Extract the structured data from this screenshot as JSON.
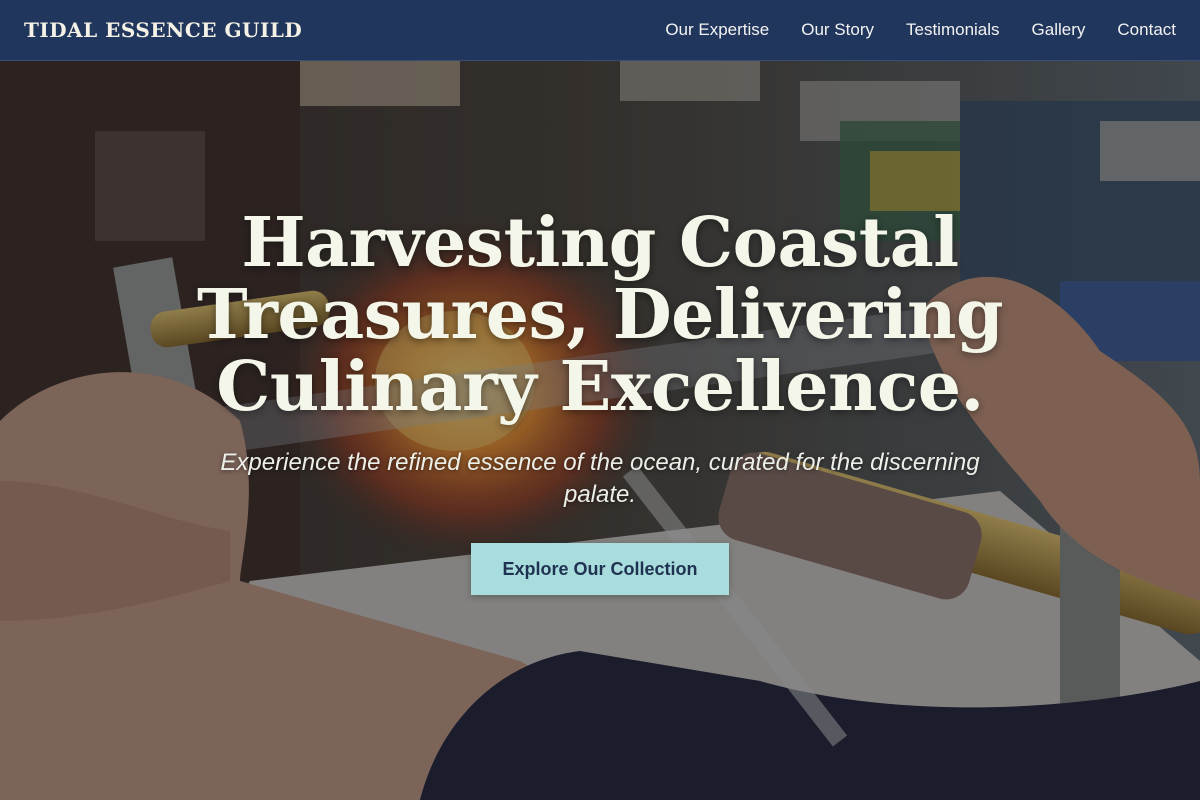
{
  "brand": {
    "name": "TIDAL ESSENCE GUILD"
  },
  "nav": {
    "links": [
      {
        "label": "Our Expertise"
      },
      {
        "label": "Our Story"
      },
      {
        "label": "Testimonials"
      },
      {
        "label": "Gallery"
      },
      {
        "label": "Contact"
      }
    ]
  },
  "hero": {
    "title_lines": [
      "Harvesting Coastal",
      "Treasures, Delivering",
      "Culinary Excellence."
    ],
    "subtitle": "Experience the refined essence of the ocean, curated for the discerning palate.",
    "cta_label": "Explore Our Collection"
  },
  "colors": {
    "nav_background": "#21365c",
    "title_text": "#f3f6e8",
    "cta_background": "#a9dcdc",
    "cta_text": "#1f3252"
  }
}
